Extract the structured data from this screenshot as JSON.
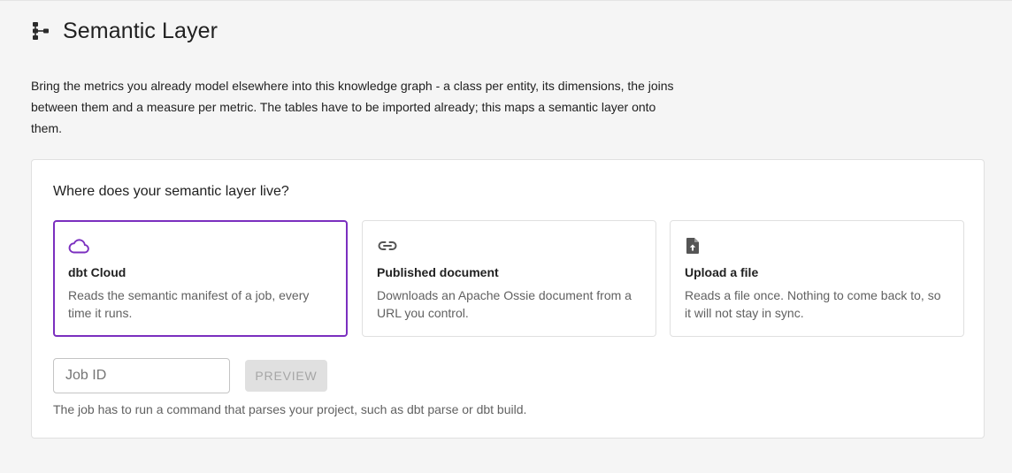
{
  "page": {
    "title": "Semantic Layer",
    "icon": "schema-icon",
    "intro": "Bring the metrics you already model elsewhere into this knowledge graph - a class per entity, its dimensions, the joins between them and a measure per metric. The tables have to be imported already; this maps a semantic layer onto them."
  },
  "panel": {
    "question": "Where does your semantic layer live?",
    "sources": [
      {
        "icon": "cloud-icon",
        "title": "dbt Cloud",
        "description": "Reads the semantic manifest of a job, every time it runs.",
        "selected": true
      },
      {
        "icon": "link-icon",
        "title": "Published document",
        "description": "Downloads an Apache Ossie document from a URL you control.",
        "selected": false
      },
      {
        "icon": "file-upload-icon",
        "title": "Upload a file",
        "description": "Reads a file once. Nothing to come back to, so it will not stay in sync.",
        "selected": false
      }
    ],
    "job_id": {
      "placeholder": "Job ID",
      "value": ""
    },
    "preview_label": "PREVIEW",
    "helper_text": "The job has to run a command that parses your project, such as dbt parse or dbt build."
  },
  "colors": {
    "accent": "#7b2fbf",
    "background": "#f5f5f5",
    "disabled_button": "#e0e0e0"
  }
}
